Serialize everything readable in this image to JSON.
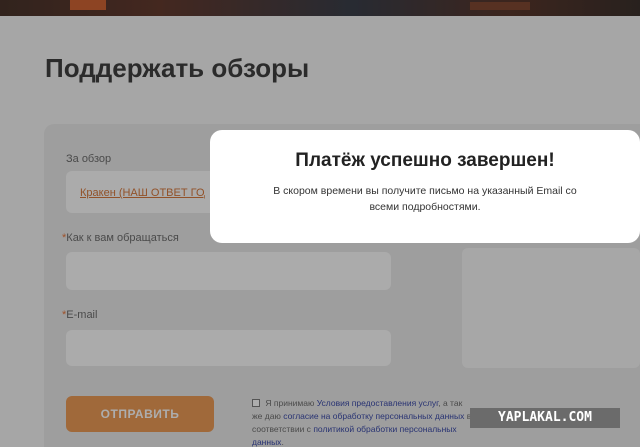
{
  "page": {
    "title": "Поддержать обзоры"
  },
  "form": {
    "review_label": "За обзор",
    "review_value": "Кракен (НАШ ОТВЕТ ГОДЗИЛЛЕ)",
    "name_required_mark": "*",
    "name_label": "Как к вам обращаться",
    "email_required_mark": "*",
    "email_label": "E-mail",
    "submit_label": "ОТПРАВИТЬ",
    "consent": {
      "prefix": "Я принимаю",
      "terms_link": "Условия предоставления услуг",
      "middle": ", а так же даю",
      "agreement_link": "согласие на обработку персональных данных",
      "middle2": "в соответствии с",
      "policy_link": "политикой обработки персональных данных",
      "suffix": "."
    }
  },
  "modal": {
    "title": "Платёж успешно завершен!",
    "message": "В скором времени вы получите письмо на указанный Email со всеми подробностями."
  },
  "watermark": {
    "text": "YAPLAKAL.COM"
  },
  "colors": {
    "accent": "#e98a39",
    "link": "#1a2c9a",
    "required": "#e5611c"
  }
}
